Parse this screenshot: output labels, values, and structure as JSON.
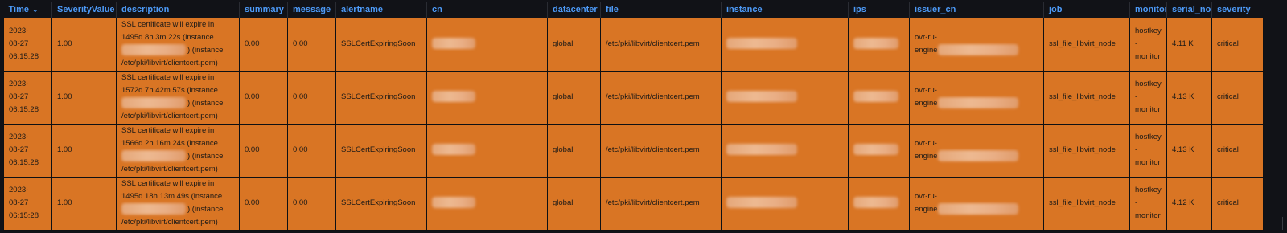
{
  "table": {
    "columns": [
      {
        "label": "Time"
      },
      {
        "label": "SeverityValue"
      },
      {
        "label": "description"
      },
      {
        "label": "summary"
      },
      {
        "label": "message"
      },
      {
        "label": "alertname"
      },
      {
        "label": "cn"
      },
      {
        "label": "datacenter"
      },
      {
        "label": "file"
      },
      {
        "label": "instance"
      },
      {
        "label": "ips"
      },
      {
        "label": "issuer_cn"
      },
      {
        "label": "job"
      },
      {
        "label": "monitor"
      },
      {
        "label": "serial_no"
      },
      {
        "label": "severity"
      }
    ],
    "sort_icon": "chevron-down-icon",
    "row_color": "#d97524",
    "header_color": "#4d9af7",
    "rows": [
      {
        "time_date": "2023-",
        "time_md": "08-27",
        "time_clock": "06:15:28",
        "severity_value": "1.00",
        "desc_line1": "SSL certificate will expire in",
        "desc_line2": "1495d 8h 3m 22s (instance",
        "desc_line3": ") (instance",
        "desc_line4": "/etc/pki/libvirt/clientcert.pem)",
        "summary": "0.00",
        "message": "0.00",
        "alertname": "SSLCertExpiringSoon",
        "datacenter": "global",
        "file": "/etc/pki/libvirt/clientcert.pem",
        "issuer_prefix": "ovr-ru-",
        "issuer_engine": "engine",
        "job": "ssl_file_libvirt_node",
        "monitor_line1": "hostkey-",
        "monitor_line2": "monitor",
        "serial_no": "4.11 K",
        "severity": "critical"
      },
      {
        "time_date": "2023-",
        "time_md": "08-27",
        "time_clock": "06:15:28",
        "severity_value": "1.00",
        "desc_line1": "SSL certificate will expire in",
        "desc_line2": "1572d 7h 42m 57s (instance",
        "desc_line3": ") (instance",
        "desc_line4": "/etc/pki/libvirt/clientcert.pem)",
        "summary": "0.00",
        "message": "0.00",
        "alertname": "SSLCertExpiringSoon",
        "datacenter": "global",
        "file": "/etc/pki/libvirt/clientcert.pem",
        "issuer_prefix": "ovr-ru-",
        "issuer_engine": "engine",
        "job": "ssl_file_libvirt_node",
        "monitor_line1": "hostkey-",
        "monitor_line2": "monitor",
        "serial_no": "4.13 K",
        "severity": "critical"
      },
      {
        "time_date": "2023-",
        "time_md": "08-27",
        "time_clock": "06:15:28",
        "severity_value": "1.00",
        "desc_line1": "SSL certificate will expire in",
        "desc_line2": "1566d 2h 16m 24s (instance",
        "desc_line3": ") (instance",
        "desc_line4": "/etc/pki/libvirt/clientcert.pem)",
        "summary": "0.00",
        "message": "0.00",
        "alertname": "SSLCertExpiringSoon",
        "datacenter": "global",
        "file": "/etc/pki/libvirt/clientcert.pem",
        "issuer_prefix": "ovr-ru-",
        "issuer_engine": "engine",
        "job": "ssl_file_libvirt_node",
        "monitor_line1": "hostkey-",
        "monitor_line2": "monitor",
        "serial_no": "4.13 K",
        "severity": "critical"
      },
      {
        "time_date": "2023-",
        "time_md": "08-27",
        "time_clock": "06:15:28",
        "severity_value": "1.00",
        "desc_line1": "SSL certificate will expire in",
        "desc_line2": "1495d 18h 13m 49s (instance",
        "desc_line3": ") (instance",
        "desc_line4": "/etc/pki/libvirt/clientcert.pem)",
        "summary": "0.00",
        "message": "0.00",
        "alertname": "SSLCertExpiringSoon",
        "datacenter": "global",
        "file": "/etc/pki/libvirt/clientcert.pem",
        "issuer_prefix": "ovr-ru-",
        "issuer_engine": "engine",
        "job": "ssl_file_libvirt_node",
        "monitor_line1": "hostkey-",
        "monitor_line2": "monitor",
        "serial_no": "4.12 K",
        "severity": "critical"
      }
    ]
  }
}
